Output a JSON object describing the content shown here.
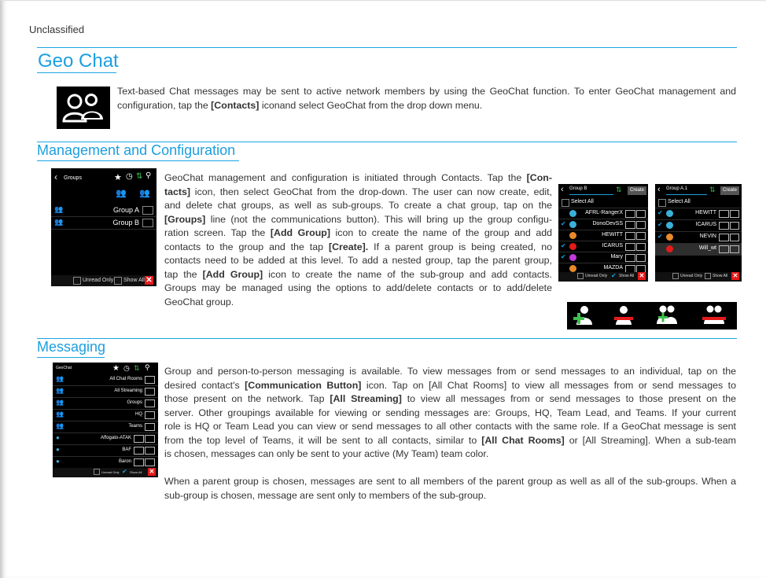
{
  "classification": "Unclassified",
  "title": "Geo Chat",
  "intro": {
    "t1": "Text-based Chat messages may be sent to active network members by using the GeoChat function. To enter GeoChat management and configuration, tap the ",
    "b1": "[Contacts]",
    "t2": " iconand select GeoChat from the drop down menu."
  },
  "management": {
    "heading": "Management and Configuration",
    "lines": [
      [
        "GeoChat management and configuration is initiated through Contacts. Tap the ",
        "[Con-",
        ""
      ],
      [
        "",
        "tacts]",
        " icon, then select GeoChat from the drop-down. The user can now create, edit,"
      ],
      [
        "and delete chat groups, as well as sub-groups. To create a chat group, tap on the",
        "",
        ""
      ],
      [
        "",
        "[Groups]",
        " line (not the communications button). This will bring up the group configu-"
      ],
      [
        "ration screen. Tap the ",
        "[Add Group]",
        " icon to create the name of the group and add"
      ],
      [
        "contacts to the group and the tap ",
        "[Create].",
        "  If a parent group is being created, no"
      ],
      [
        "contacts need to be added at this level. To add a nested group, tap the parent group,",
        "",
        ""
      ],
      [
        "tap the ",
        "[Add Group]",
        " icon to create the name of the sub-group and add contacts."
      ],
      [
        "Groups may be managed using the options to add/delete contacts or to add/delete",
        "",
        ""
      ],
      [
        "GeoChat group.",
        "",
        ""
      ]
    ],
    "groups_screen": {
      "title": "Groups",
      "rows": [
        "Group A",
        "Group B"
      ],
      "unread_only": "Unread Only",
      "show_all": "Show All"
    },
    "create_screen_1": {
      "input": "Group B",
      "create": "Create",
      "select_all": "Select All",
      "rows": [
        "AFRL-RangerX",
        "DonoDevSS",
        "HEWITT",
        "ICARUS",
        "Mary",
        "MAZDA"
      ],
      "unread_only": "Unread Only",
      "show_all": "Show All"
    },
    "create_screen_2": {
      "input": "Group A.1",
      "create": "Create",
      "select_all": "Select All",
      "rows": [
        "HEWITT",
        "ICARUS",
        "NEVIN",
        "Will_wt"
      ],
      "unread_only": "Unread Only",
      "show_all": "Show All"
    },
    "icons": [
      "add-contact-icon",
      "remove-contact-icon",
      "add-group-icon",
      "delete-group-icon"
    ]
  },
  "messaging": {
    "heading": "Messaging",
    "lines": [
      [
        "Group and person-to-person messaging is available. To view messages from or send messages to an individual, tap on the",
        "",
        ""
      ],
      [
        "desired contact's ",
        "[Communication Button]",
        " icon. Tap on [All Chat Rooms] to view all messages from or send messages to"
      ],
      [
        "those present on the network. Tap ",
        "[All Streaming]",
        " to view all messages from or send messages to those present on the"
      ],
      [
        "server. Other groupings available for viewing or sending messages are: Groups, HQ, Team Lead, and Teams. If your current",
        "",
        ""
      ],
      [
        "role is HQ or Team Lead you can view or send messages to all other contacts with the same role. If a GeoChat message is sent",
        "",
        ""
      ],
      [
        "from the top level of Teams, it will be sent to all contacts, similar to ",
        "[All Chat Rooms]",
        " or [All Streaming]. When a sub-team"
      ],
      [
        "is chosen, messages can only be sent to your active (My Team) team color.",
        "",
        ""
      ]
    ],
    "para2": "When a parent group is chosen, messages are sent to all members of the parent group as well as all of the sub-groups. When a sub-group is chosen, message are sent only to members of the sub-group.",
    "geochat_screen": {
      "title": "GeoChat",
      "rows": [
        "All Chat Rooms",
        "All Streaming",
        "Groups",
        "HQ",
        "Teams",
        "Affogato-ATAK",
        "BAF",
        "Baron"
      ],
      "unread_only": "Unread Only",
      "show_all": "Show All"
    }
  },
  "colors": {
    "accent": "#1b9fe0",
    "green": "#3fbf4b",
    "red": "#e51b1b"
  }
}
